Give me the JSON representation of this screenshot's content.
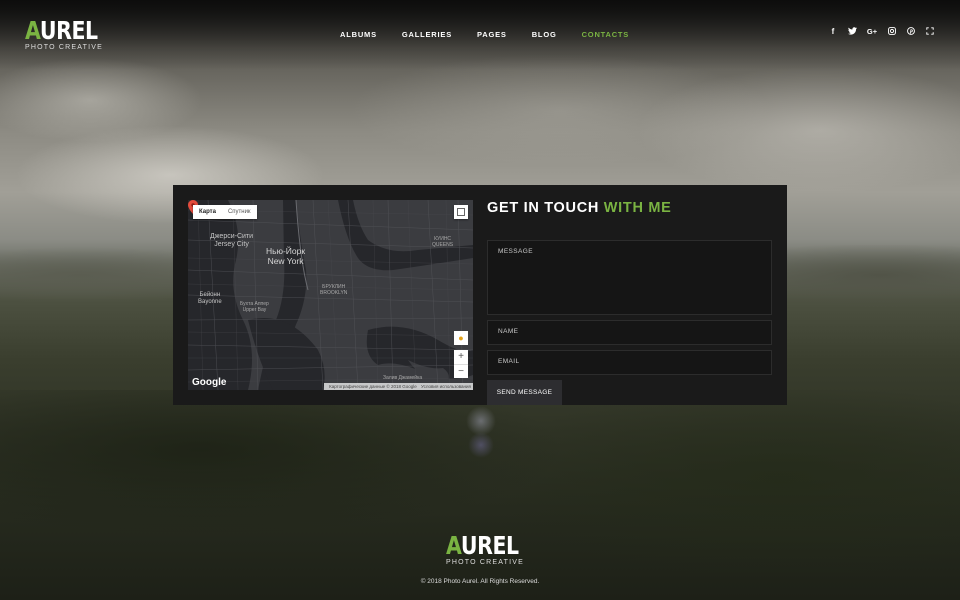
{
  "brand": {
    "accent_letter": "A",
    "rest": "UREL",
    "subtitle": "PHOTO CREATIVE",
    "accent_color": "#7ab342"
  },
  "nav": [
    {
      "label": "ALBUMS",
      "active": false
    },
    {
      "label": "GALLERIES",
      "active": false
    },
    {
      "label": "PAGES",
      "active": false
    },
    {
      "label": "BLOG",
      "active": false
    },
    {
      "label": "CONTACTS",
      "active": true
    }
  ],
  "social": [
    {
      "icon": "facebook-icon",
      "glyph": "f"
    },
    {
      "icon": "twitter-icon",
      "glyph": "🐦"
    },
    {
      "icon": "google-plus-icon",
      "glyph": "G+"
    },
    {
      "icon": "instagram-icon",
      "glyph": "◎"
    },
    {
      "icon": "pinterest-icon",
      "glyph": "℗"
    },
    {
      "icon": "fullscreen-icon",
      "glyph": "⛶"
    }
  ],
  "map": {
    "tab_map": "Карта",
    "tab_satellite": "Спутник",
    "labels": {
      "jersey": "Джерси-Сити\nJersey City",
      "newyork": "Нью-Йорк\nNew York",
      "queens": "КУИНС\nQUEENS",
      "brooklyn": "БРУКЛИН\nBROOKLYN",
      "bayonne": "Бейонн\nBayonne",
      "upperbay": "Бухта Аппер\nUpper Bay",
      "jamaica": "Залив Джамейка"
    },
    "google": "Google",
    "attribution": "Картографические данные © 2018 Google",
    "terms": "Условия использования",
    "zoom_in": "+",
    "zoom_out": "−"
  },
  "form": {
    "title_main": "GET IN TOUCH",
    "title_accent": "WITH ME",
    "message_placeholder": "MESSAGE",
    "name_placeholder": "NAME",
    "email_placeholder": "EMAIL",
    "send_label": "SEND MESSAGE"
  },
  "footer": {
    "copyright": "© 2018 Photo Aurel. All Rights Reserved."
  }
}
